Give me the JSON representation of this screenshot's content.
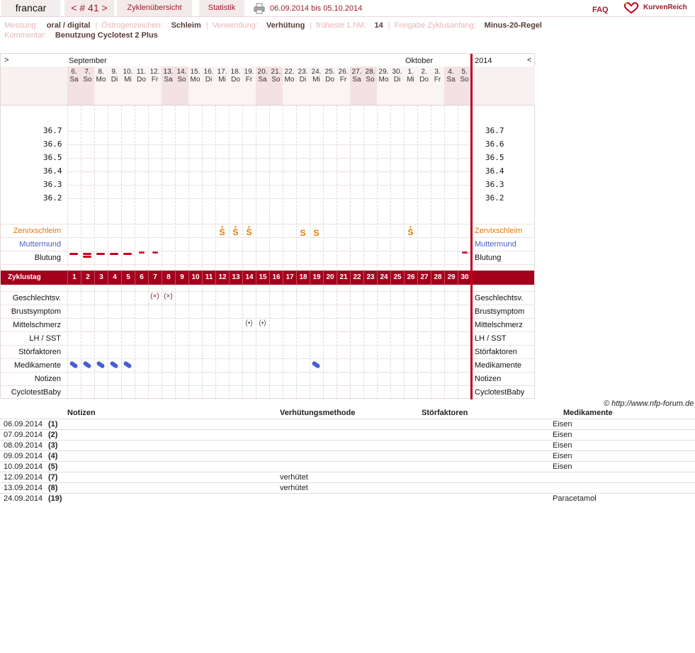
{
  "nav": {
    "user": "francar",
    "cycle": "< # 41 >",
    "overview": "Zyklenübersicht",
    "stats": "Statistik",
    "date_range": "06.09.2014 bis 05.10.2014",
    "faq": "FAQ",
    "brand": "KurvenReich"
  },
  "info": {
    "messung_label": "Messung:",
    "messung_value": "oral / digital",
    "oestrogen_label": "Östrogenzeichen:",
    "oestrogen_value": "Schleim",
    "verwendung_label": "Verwendung:",
    "verwendung_value": "Verhütung",
    "hm_label": "früheste 1.hM:",
    "hm_value": "14",
    "freigabe_label": "Freigabe Zyklusanfang:",
    "freigabe_value": "Minus-20-Regel",
    "kommentar_label": "Kommentar:",
    "kommentar_value": "Benutzung Cyclotest 2 Plus"
  },
  "chart": {
    "nav_left": ">",
    "nav_right": "<",
    "month1": "September",
    "month2": "Oktober",
    "year": "2014",
    "days": [
      {
        "d": "6.",
        "w": "Sa",
        "we": true
      },
      {
        "d": "7.",
        "w": "So",
        "we": true
      },
      {
        "d": "8.",
        "w": "Mo",
        "we": false
      },
      {
        "d": "9.",
        "w": "Di",
        "we": false
      },
      {
        "d": "10.",
        "w": "Mi",
        "we": false
      },
      {
        "d": "11.",
        "w": "Do",
        "we": false
      },
      {
        "d": "12.",
        "w": "Fr",
        "we": false
      },
      {
        "d": "13.",
        "w": "Sa",
        "we": true
      },
      {
        "d": "14.",
        "w": "So",
        "we": true
      },
      {
        "d": "15.",
        "w": "Mo",
        "we": false
      },
      {
        "d": "16.",
        "w": "Di",
        "we": false
      },
      {
        "d": "17.",
        "w": "Mi",
        "we": false
      },
      {
        "d": "18.",
        "w": "Do",
        "we": false
      },
      {
        "d": "19.",
        "w": "Fr",
        "we": false
      },
      {
        "d": "20.",
        "w": "Sa",
        "we": true
      },
      {
        "d": "21.",
        "w": "So",
        "we": true
      },
      {
        "d": "22.",
        "w": "Mo",
        "we": false
      },
      {
        "d": "23.",
        "w": "Di",
        "we": false
      },
      {
        "d": "24.",
        "w": "Mi",
        "we": false
      },
      {
        "d": "25.",
        "w": "Do",
        "we": false
      },
      {
        "d": "26.",
        "w": "Fr",
        "we": false
      },
      {
        "d": "27.",
        "w": "Sa",
        "we": true
      },
      {
        "d": "28.",
        "w": "So",
        "we": true
      },
      {
        "d": "29.",
        "w": "Mo",
        "we": false
      },
      {
        "d": "30.",
        "w": "Di",
        "we": false
      },
      {
        "d": "1.",
        "w": "Mi",
        "we": false
      },
      {
        "d": "2.",
        "w": "Do",
        "we": false
      },
      {
        "d": "3.",
        "w": "Fr",
        "we": false
      },
      {
        "d": "4.",
        "w": "Sa",
        "we": true
      },
      {
        "d": "5.",
        "w": "So",
        "we": true
      }
    ],
    "temps": [
      "36.7",
      "36.6",
      "36.5",
      "36.4",
      "36.3",
      "36.2"
    ],
    "rows_upper": [
      "Zervixschleim",
      "Muttermund",
      "Blutung"
    ],
    "zyklustag_label": "Zyklustag",
    "rows_lower": [
      "Geschlechtsv.",
      "Brustsymptom",
      "Mittelschmerz",
      "LH / SST",
      "Störfaktoren",
      "Medikamente",
      "Notizen",
      "CyclotestBaby"
    ],
    "mucus": [
      {
        "day": 12,
        "sym": "S",
        "plus": "+"
      },
      {
        "day": 13,
        "sym": "S",
        "plus": "+"
      },
      {
        "day": 14,
        "sym": "S",
        "plus": "+"
      },
      {
        "day": 18,
        "sym": "S",
        "plus": ""
      },
      {
        "day": 19,
        "sym": "S",
        "plus": ""
      },
      {
        "day": 26,
        "sym": "S",
        "plus": "+"
      }
    ],
    "bleeding": [
      {
        "day": 1,
        "type": "dash"
      },
      {
        "day": 2,
        "type": "double"
      },
      {
        "day": 3,
        "type": "dash"
      },
      {
        "day": 4,
        "type": "dash"
      },
      {
        "day": 5,
        "type": "dash"
      },
      {
        "day": 6,
        "type": "dots"
      },
      {
        "day": 7,
        "type": "dots"
      },
      {
        "day": 30,
        "type": "dots"
      }
    ],
    "sex": [
      {
        "day": 7,
        "sym": "(×)"
      },
      {
        "day": 8,
        "sym": "(×)"
      }
    ],
    "mittelschmerz": [
      {
        "day": 14,
        "sym": "(•)"
      },
      {
        "day": 15,
        "sym": "(•)"
      }
    ],
    "medication_days": [
      1,
      2,
      3,
      4,
      5,
      19
    ],
    "copyright": "© http://www.nfp-forum.de"
  },
  "table": {
    "headers": {
      "notes": "Notizen",
      "method": "Verhütungsmethode",
      "factors": "Störfaktoren",
      "meds": "Medikamente"
    },
    "rows": [
      {
        "date": "06.09.2014",
        "day": "(1)",
        "method": "",
        "meds": "Eisen"
      },
      {
        "date": "07.09.2014",
        "day": "(2)",
        "method": "",
        "meds": "Eisen"
      },
      {
        "date": "08.09.2014",
        "day": "(3)",
        "method": "",
        "meds": "Eisen"
      },
      {
        "date": "09.09.2014",
        "day": "(4)",
        "method": "",
        "meds": "Eisen"
      },
      {
        "date": "10.09.2014",
        "day": "(5)",
        "method": "",
        "meds": "Eisen"
      },
      {
        "date": "12.09.2014",
        "day": "(7)",
        "method": "verhütet",
        "meds": ""
      },
      {
        "date": "13.09.2014",
        "day": "(8)",
        "method": "verhütet",
        "meds": ""
      },
      {
        "date": "24.09.2014",
        "day": "(19)",
        "method": "",
        "meds": "Paracetamol"
      }
    ]
  }
}
